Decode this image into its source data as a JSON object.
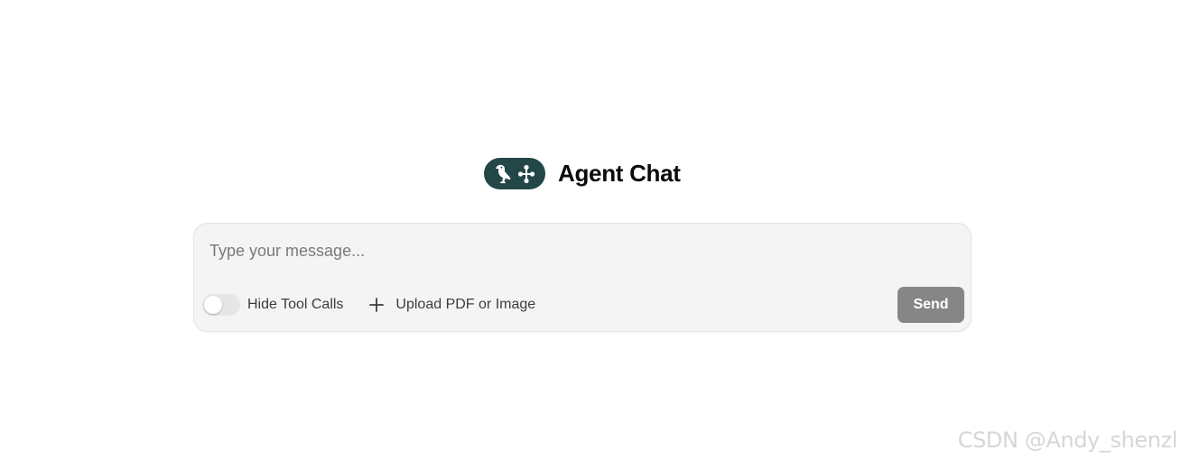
{
  "app": {
    "title": "Agent Chat",
    "logo_icons": [
      "parrot-icon",
      "graph-nodes-icon"
    ],
    "logo_color": "#234647"
  },
  "composer": {
    "placeholder": "Type your message...",
    "value": "",
    "hide_tool_calls": {
      "label": "Hide Tool Calls",
      "enabled": false
    },
    "upload_label": "Upload PDF or Image",
    "upload_icon": "plus-icon",
    "send_label": "Send",
    "send_color": "#868686"
  },
  "watermark": {
    "text": "CSDN @Andy_shenzl"
  }
}
